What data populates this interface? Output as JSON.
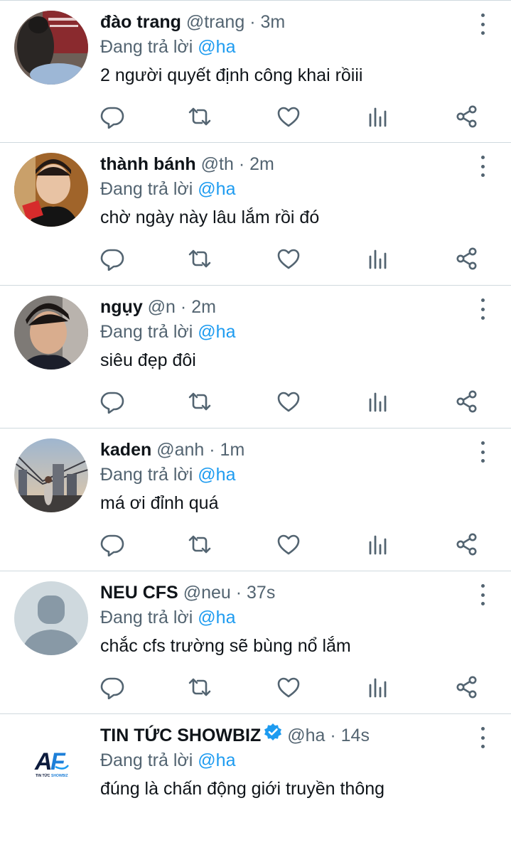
{
  "reply_prefix": "Đang trả lời",
  "tweets": [
    {
      "name": "đào trang",
      "handle": "@trang",
      "sep": "·",
      "time": "3m",
      "mention": "@ha",
      "text": "2 người quyết định công khai rồiii"
    },
    {
      "name": "thành bánh",
      "handle": "@th",
      "sep": "·",
      "time": "2m",
      "mention": "@ha",
      "text": "chờ ngày này lâu lắm rồi đó"
    },
    {
      "name": "ngụy",
      "handle": "@n",
      "sep": "·",
      "time": "2m",
      "mention": "@ha",
      "text": "siêu đẹp đôi"
    },
    {
      "name": "kaden",
      "handle": "@anh",
      "sep": "·",
      "time": "1m",
      "mention": "@ha",
      "text": "má ơi đỉnh quá"
    },
    {
      "name": "NEU CFS",
      "handle": "@neu",
      "sep": "·",
      "time": "37s",
      "mention": "@ha",
      "text": "chắc cfs trường sẽ bùng nổ lắm"
    },
    {
      "name": "TIN TỨC SHOWBIZ",
      "handle": "@ha",
      "sep": "·",
      "time": "14s",
      "mention": "@ha",
      "text": "đúng là chấn động giới truyền thông",
      "verified": true,
      "logo_text": "AF",
      "logo_sub": "TIN TỨC SHOWBIZ"
    }
  ],
  "colors": {
    "accent": "#1d9bf0",
    "muted": "#536471",
    "divider": "#cfd9de"
  }
}
